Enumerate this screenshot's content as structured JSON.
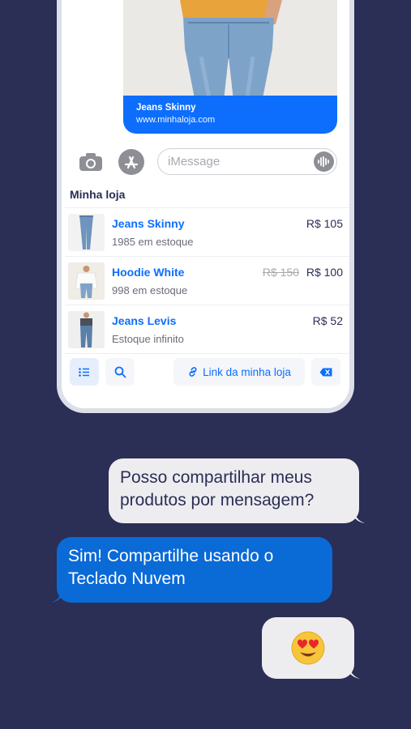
{
  "preview": {
    "product_title": "Jeans Skinny",
    "url": "www.minhaloja.com"
  },
  "input": {
    "placeholder": "iMessage"
  },
  "store": {
    "title": "Minha loja",
    "products": [
      {
        "name": "Jeans Skinny",
        "stock": "1985 em estoque",
        "price": "R$ 105",
        "old_price": ""
      },
      {
        "name": "Hoodie White",
        "stock": "998 em estoque",
        "price": "R$ 100",
        "old_price": "R$ 150"
      },
      {
        "name": "Jeans Levis",
        "stock": "Estoque infinito",
        "price": "R$ 52",
        "old_price": ""
      }
    ]
  },
  "toolbar": {
    "link_label": "Link da minha loja"
  },
  "chat": {
    "question": "Posso compartilhar meus produtos por mensagem?",
    "answer": "Sim! Compartilhe usando o Teclado Nuvem",
    "reaction": "😍"
  },
  "colors": {
    "background": "#2b2e55",
    "accent": "#0d6efd",
    "bubble_blue": "#0a6ad6",
    "bubble_gray": "#ededf0"
  }
}
